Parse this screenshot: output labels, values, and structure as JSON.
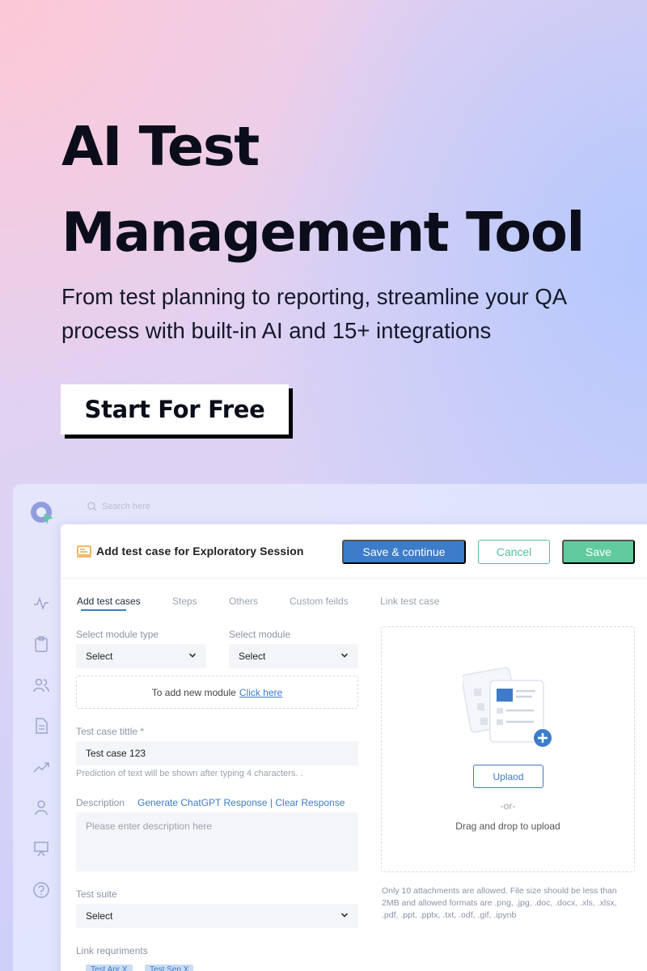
{
  "hero": {
    "title_line1": "AI Test",
    "title_line2": "Management Tool",
    "subtitle": "From test planning to reporting, streamline your QA process with built-in AI and 15+ integrations",
    "cta_label": "Start For Free"
  },
  "app": {
    "search_placeholder": "Search here",
    "sidebar_icons": [
      "activity-icon",
      "clipboard-icon",
      "users-icon",
      "document-icon",
      "trending-icon",
      "person-icon",
      "presentation-icon",
      "help-icon"
    ]
  },
  "modal": {
    "title": "Add test case for Exploratory Session",
    "buttons": {
      "save_continue": "Save & continue",
      "cancel": "Cancel",
      "save": "Save"
    },
    "tabs": [
      {
        "label": "Add test cases",
        "active": true
      },
      {
        "label": "Steps",
        "active": false
      },
      {
        "label": "Others",
        "active": false
      },
      {
        "label": "Custom feilds",
        "active": false
      },
      {
        "label": "Link test case",
        "active": false
      }
    ],
    "module_type": {
      "label": "Select module type",
      "value": "Select"
    },
    "module": {
      "label": "Select module",
      "value": "Select"
    },
    "add_module": {
      "text": "To add new module",
      "link": "Click here"
    },
    "test_case_title": {
      "label": "Test case tittle *",
      "value": "Test case 123",
      "hint": "Prediction of text will be shown after typing 4 characters. ."
    },
    "description": {
      "label": "Description",
      "link_generate": "Generate ChatGPT Response",
      "separator": "|",
      "link_clear": "Clear Response",
      "placeholder": "Please enter description here"
    },
    "test_suite": {
      "label": "Test suite",
      "value": "Select"
    },
    "link_requirements": {
      "label": "Link requriments",
      "chips": [
        "Test Apr X",
        "Test Sep X"
      ]
    },
    "upload": {
      "button": "Uplaod",
      "or": "-or-",
      "drag": "Drag and drop to upload",
      "note": "Only 10 attachments are allowed. File size should be less than 2MB and allowed formats are .png, .jpg, .doc, .docx, .xls, .xlsx, .pdf, .ppt, .pptx, .txt, .odf, .gif, .ipynb"
    }
  },
  "colors": {
    "primary_blue": "#3d7cc9",
    "green": "#5fcb9f",
    "cta_shadow": "#000000"
  }
}
